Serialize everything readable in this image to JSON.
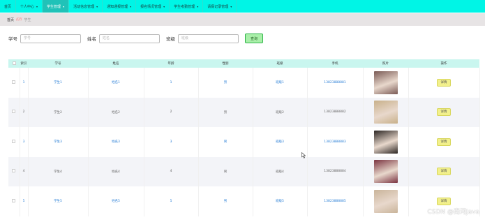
{
  "nav": {
    "items": [
      {
        "label": "首页",
        "caret": false,
        "active": false
      },
      {
        "label": "个人中心",
        "caret": true,
        "active": false
      },
      {
        "label": "学生管理",
        "caret": true,
        "active": true
      },
      {
        "label": "活动信息管理",
        "caret": true,
        "active": false
      },
      {
        "label": "通知通报管理",
        "caret": true,
        "active": false
      },
      {
        "label": "报名情况管理",
        "caret": true,
        "active": false
      },
      {
        "label": "学生考勤管理",
        "caret": true,
        "active": false
      },
      {
        "label": "请假记录管理",
        "caret": true,
        "active": false
      }
    ]
  },
  "breadcrumb": {
    "home": "首页",
    "sep": "/////",
    "current": "学生"
  },
  "search": {
    "fields": [
      {
        "label": "学号",
        "placeholder": "学号"
      },
      {
        "label": "姓名",
        "placeholder": "姓名"
      },
      {
        "label": "班级",
        "placeholder": "班级"
      }
    ],
    "button": "查询"
  },
  "table": {
    "headers": [
      "",
      "索引",
      "学号",
      "姓名",
      "年龄",
      "性别",
      "班级",
      "手机",
      "照片",
      "操作"
    ],
    "rows": [
      {
        "index": "1",
        "id": "学生1",
        "name": "姓名1",
        "age": "1",
        "gender": "男",
        "class": "班级1",
        "phone": "13823888881",
        "action": "详情",
        "photo_color": "#7a5a55"
      },
      {
        "index": "2",
        "id": "学生2",
        "name": "姓名2",
        "age": "2",
        "gender": "男",
        "class": "班级2",
        "phone": "13823888882",
        "action": "详情",
        "photo_color": "#c8b08a"
      },
      {
        "index": "3",
        "id": "学生3",
        "name": "姓名3",
        "age": "3",
        "gender": "男",
        "class": "班级3",
        "phone": "13823888883",
        "action": "详情",
        "photo_color": "#2b2522"
      },
      {
        "index": "4",
        "id": "学生4",
        "name": "姓名4",
        "age": "4",
        "gender": "男",
        "class": "班级4",
        "phone": "13823888884",
        "action": "详情",
        "photo_color": "#7a3340"
      },
      {
        "index": "5",
        "id": "学生5",
        "name": "姓名5",
        "age": "5",
        "gender": "男",
        "class": "班级5",
        "phone": "13823888885",
        "action": "详情",
        "photo_color": "#c9b49a"
      }
    ]
  },
  "watermark": "CSDN @南河Java"
}
